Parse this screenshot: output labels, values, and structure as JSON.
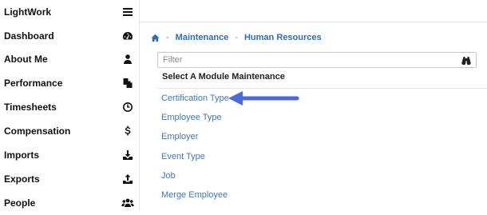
{
  "sidebar": {
    "title": "LightWork",
    "items": [
      {
        "label": "Dashboard",
        "icon": "dashboard-gauge-icon"
      },
      {
        "label": "About Me",
        "icon": "user-icon"
      },
      {
        "label": "Performance",
        "icon": "copy-icon"
      },
      {
        "label": "Timesheets",
        "icon": "clock-icon"
      },
      {
        "label": "Compensation",
        "icon": "dollar-icon"
      },
      {
        "label": "Imports",
        "icon": "download-icon"
      },
      {
        "label": "Exports",
        "icon": "upload-icon"
      },
      {
        "label": "People",
        "icon": "users-icon"
      }
    ]
  },
  "breadcrumb": {
    "items": [
      "Maintenance",
      "Human Resources"
    ],
    "separator": "-"
  },
  "filter": {
    "placeholder": "Filter",
    "value": ""
  },
  "modules": {
    "header": "Select A Module Maintenance",
    "items": [
      "Certification Type",
      "Employee Type",
      "Employer",
      "Event Type",
      "Job",
      "Merge Employee"
    ]
  },
  "colors": {
    "link": "#3b78b7",
    "arrow": "#4a68e0"
  }
}
